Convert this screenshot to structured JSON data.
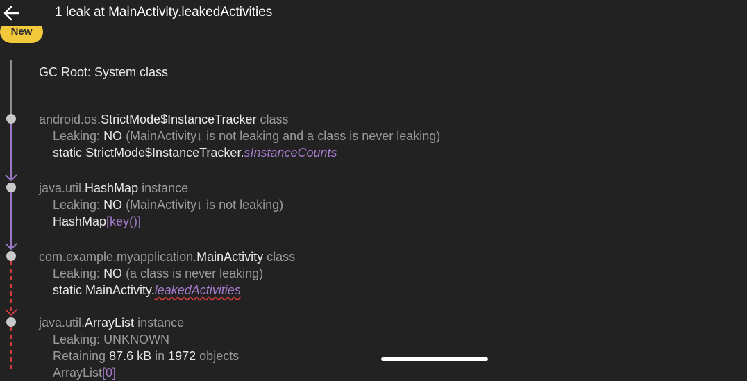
{
  "header": {
    "back_icon": "arrow-left-icon",
    "title": "1 leak at MainActivity.leakedActivities"
  },
  "badge": {
    "label": "New"
  },
  "colors": {
    "background": "#222222",
    "text_primary": "#e8e8e8",
    "text_secondary": "#9a9a9a",
    "reference_purple": "#a27bc9",
    "leak_red": "#d23b3b",
    "badge_yellow": "#f3c93c"
  },
  "trace": [
    {
      "title": {
        "prefix": "GC Root: System class"
      }
    },
    {
      "title": {
        "pkg": "android.os.",
        "cls": "StrictMode$InstanceTracker",
        "kind": " class"
      },
      "leaking": {
        "label": "Leaking: ",
        "value": "NO",
        "reason": " (MainActivity↓ is not leaking and a class is never leaking)"
      },
      "ref": {
        "owner": "static StrictMode$InstanceTracker.",
        "field": "sInstanceCounts"
      }
    },
    {
      "title": {
        "pkg": "java.util.",
        "cls": "HashMap",
        "kind": " instance"
      },
      "leaking": {
        "label": "Leaking: ",
        "value": "NO",
        "reason": " (MainActivity↓ is not leaking)"
      },
      "ref": {
        "owner": "HashMap",
        "field": "[key()]"
      }
    },
    {
      "title": {
        "pkg": "com.example.myapplication.",
        "cls": "MainActivity",
        "kind": " class"
      },
      "leaking": {
        "label": "Leaking: ",
        "value": "NO",
        "reason": " (a class is never leaking)"
      },
      "ref": {
        "owner": "static MainActivity.",
        "field": "leakedActivities"
      }
    },
    {
      "title": {
        "pkg": "java.util.",
        "cls": "ArrayList",
        "kind": " instance"
      },
      "leaking": {
        "label": "Leaking: ",
        "value": "UNKNOWN"
      },
      "retaining": {
        "label": "Retaining ",
        "size": "87.6 kB",
        "mid": " in ",
        "count": "1972",
        "tail": " objects"
      },
      "ref": {
        "owner": "ArrayList",
        "field": "[0]"
      }
    }
  ]
}
